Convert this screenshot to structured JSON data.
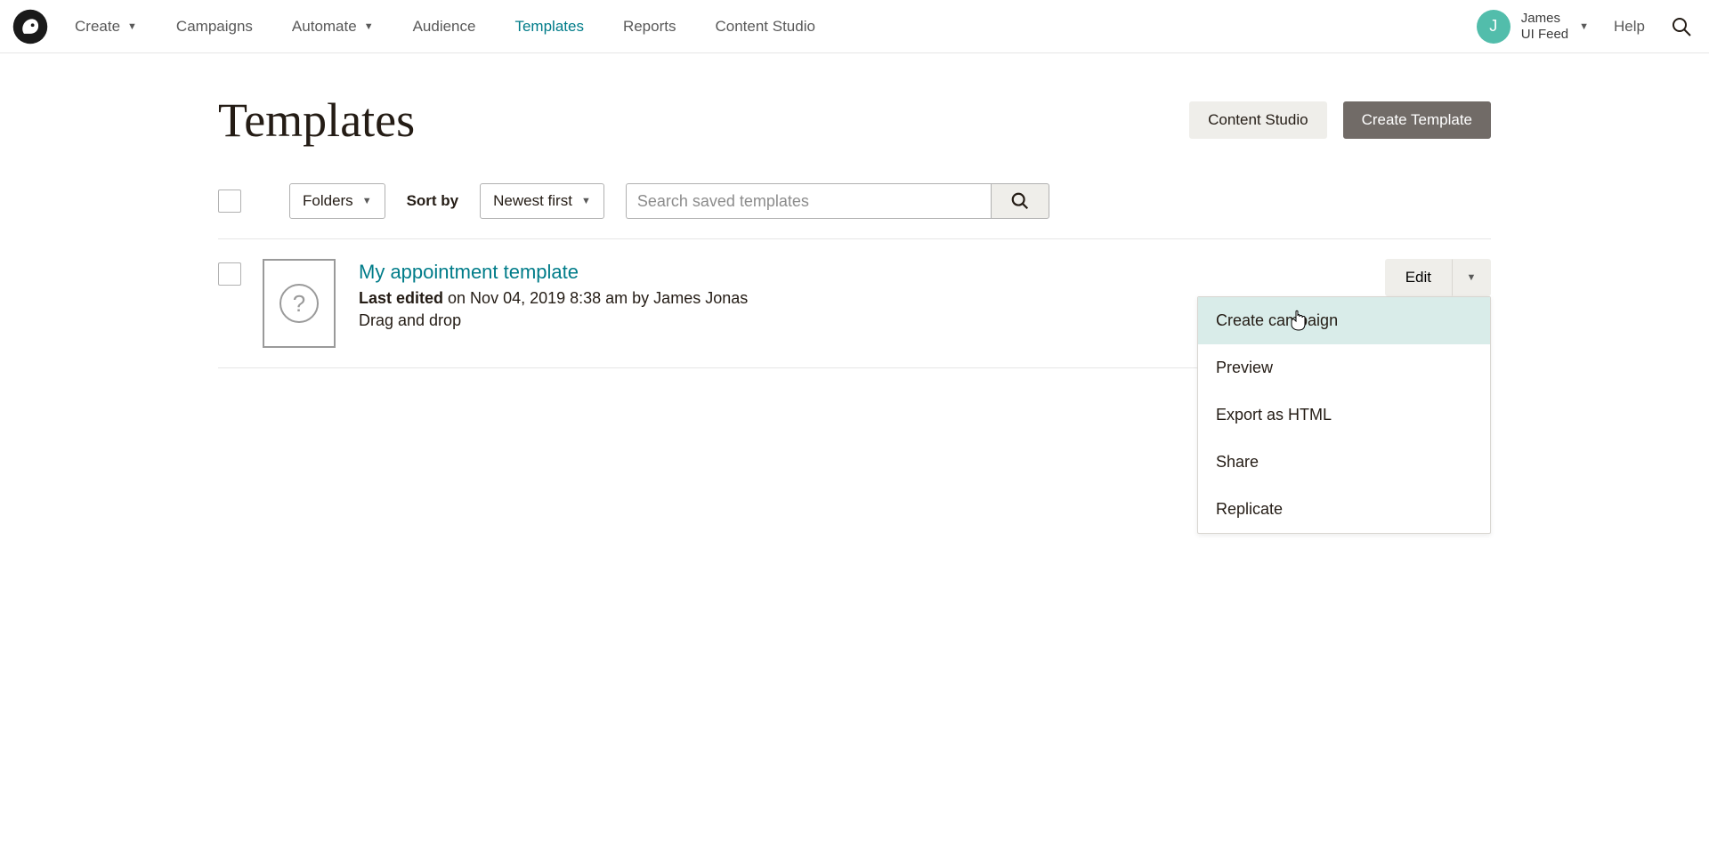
{
  "nav": {
    "items": [
      {
        "label": "Create",
        "caret": true
      },
      {
        "label": "Campaigns",
        "caret": false
      },
      {
        "label": "Automate",
        "caret": true
      },
      {
        "label": "Audience",
        "caret": false
      },
      {
        "label": "Templates",
        "caret": false,
        "active": true
      },
      {
        "label": "Reports",
        "caret": false
      },
      {
        "label": "Content Studio",
        "caret": false
      }
    ],
    "account": {
      "avatar_initial": "J",
      "name": "James",
      "org": "UI Feed"
    },
    "help_label": "Help"
  },
  "page": {
    "title": "Templates",
    "content_studio_btn": "Content Studio",
    "create_template_btn": "Create Template"
  },
  "toolbar": {
    "folders_label": "Folders",
    "sort_by_label": "Sort by",
    "sort_value": "Newest first",
    "search_placeholder": "Search saved templates"
  },
  "template": {
    "title": "My appointment template",
    "meta_strong": "Last edited",
    "meta_rest": " on Nov 04, 2019 8:38 am by James Jonas",
    "type": "Drag and drop",
    "edit_label": "Edit"
  },
  "dropdown": {
    "items": [
      "Create campaign",
      "Preview",
      "Export as HTML",
      "Share",
      "Replicate"
    ]
  }
}
